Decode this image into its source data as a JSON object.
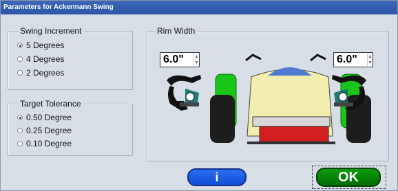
{
  "window": {
    "title": "Parameters for Ackermann Swing"
  },
  "swing_increment": {
    "legend": "Swing Increment",
    "options": [
      "5 Degrees",
      "4 Degrees",
      "2 Degrees"
    ],
    "selected_index": 0
  },
  "target_tolerance": {
    "legend": "Target Tolerance",
    "options": [
      "0.50 Degree",
      "0.25 Degree",
      "0.10 Degree"
    ],
    "selected_index": 0
  },
  "rim_width": {
    "legend": "Rim Width",
    "left_value": "6.0\"",
    "right_value": "6.0\""
  },
  "buttons": {
    "info_label": "i",
    "ok_label": "OK"
  },
  "colors": {
    "titlebar": "#2f5cb0",
    "info": "#1e5ce6",
    "ok": "#0a8a0a"
  }
}
